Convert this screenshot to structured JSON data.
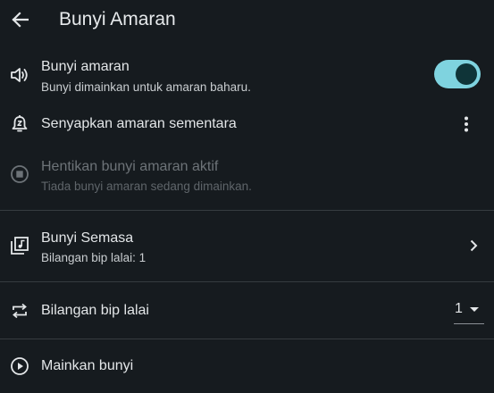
{
  "app_bar": {
    "title": "Bunyi Amaran",
    "back_icon": "arrow-back-icon"
  },
  "settings": [
    {
      "title": "Bunyi amaran",
      "subtitle": "Bunyi dimainkan untuk amaran baharu.",
      "icon": "volume-icon",
      "control": "toggle",
      "toggle_on": true,
      "enabled": true
    },
    {
      "title": "Senyapkan amaran sementara",
      "icon": "alarm-snooze-icon",
      "control": "overflow-menu",
      "enabled": true
    },
    {
      "title": "Hentikan bunyi amaran aktif",
      "subtitle": "Tiada bunyi amaran sedang dimainkan.",
      "icon": "stop-circle-icon",
      "enabled": false
    },
    {
      "title": "Bunyi Semasa",
      "subtitle": "Bilangan bip lalai: 1",
      "icon": "music-library-icon",
      "control": "chevron",
      "enabled": true
    },
    {
      "title": "Bilangan bip lalai",
      "icon": "repeat-icon",
      "control": "dropdown",
      "selected_value": "1",
      "enabled": true
    },
    {
      "title": "Mainkan bunyi",
      "icon": "play-circle-icon",
      "enabled": true
    }
  ],
  "colors": {
    "background": "#161b1f",
    "accent": "#7fd3df",
    "toggle_thumb": "#0f3438",
    "divider": "#363c40",
    "text_primary": "#e3e6e8",
    "text_disabled": "#6d7378"
  }
}
